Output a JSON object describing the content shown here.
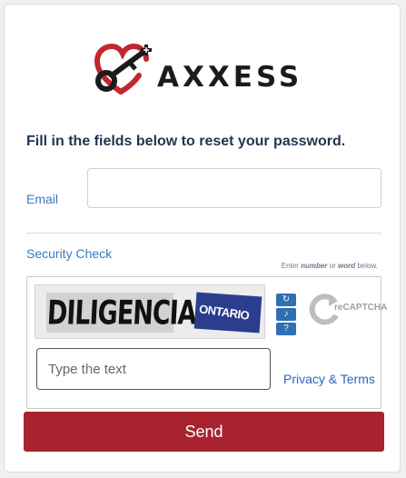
{
  "logo": {
    "brand_text": "AXXESS"
  },
  "form": {
    "instruction": "Fill in the fields below to reset your password.",
    "email_label": "Email",
    "email_value": "",
    "security_label": "Security Check",
    "hint_prefix": "Enter ",
    "hint_number": "number",
    "hint_or": " or ",
    "hint_word": "word",
    "hint_suffix": " below.",
    "captcha_word_1": "DILIGENCIAS",
    "captcha_word_2": "ONTARIO",
    "captcha_placeholder": "Type the text",
    "recaptcha_logo_text": "reCAPTCHA",
    "privacy_link": "Privacy & Terms",
    "send_label": "Send"
  },
  "colors": {
    "accent_red": "#a8232f",
    "link_blue": "#2f5fc0",
    "label_blue": "#3a7bbf",
    "heading_navy": "#1f3550",
    "captcha_button_blue": "#2f6fb3"
  },
  "icons": [
    "key-heart-logo-icon",
    "refresh-icon",
    "audio-icon",
    "help-icon",
    "recaptcha-logo-icon"
  ]
}
